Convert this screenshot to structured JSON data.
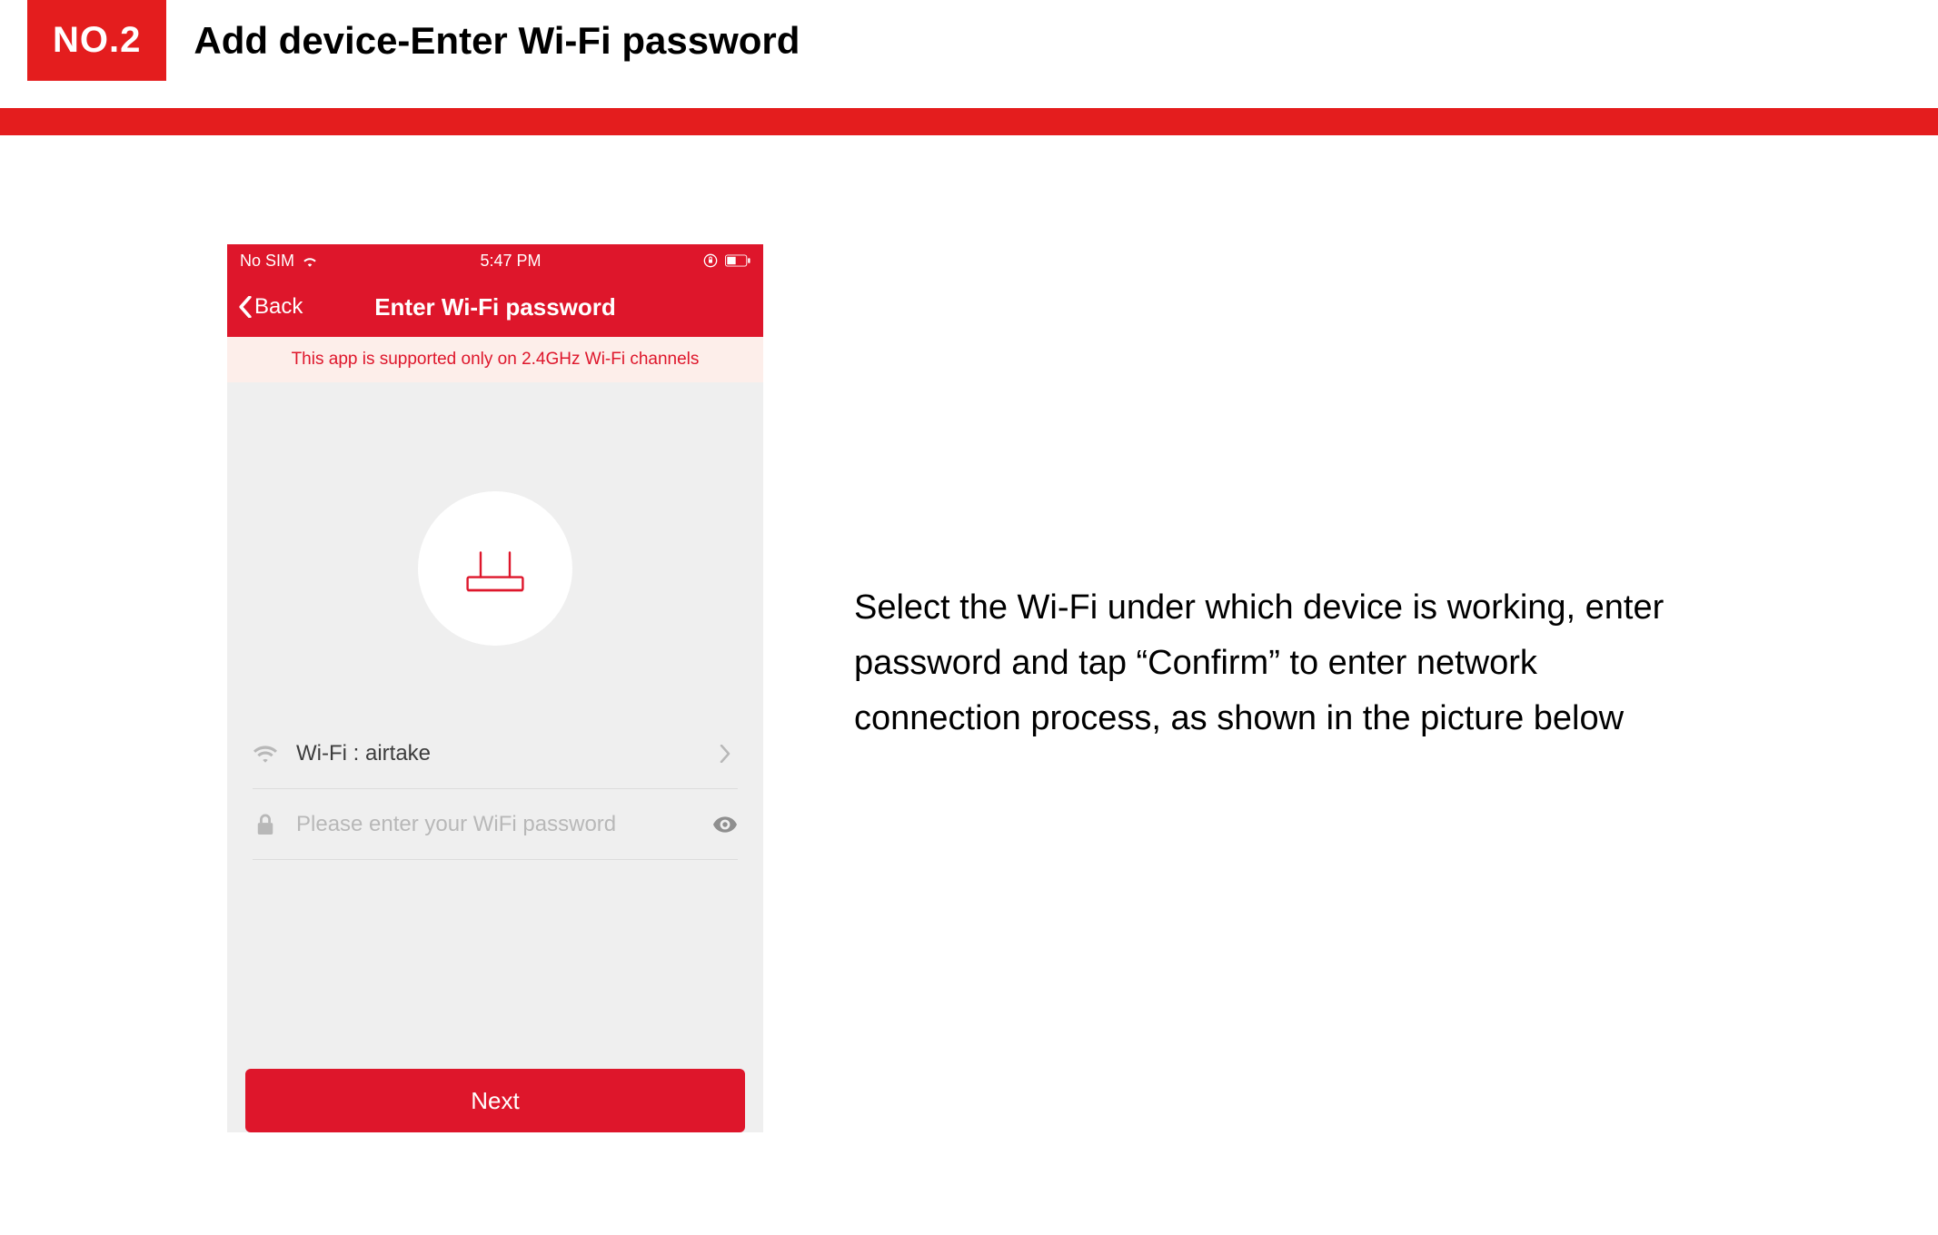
{
  "header": {
    "badge": "NO.2",
    "heading": "Add device-Enter Wi-Fi password"
  },
  "phone": {
    "status": {
      "carrier": "No SIM",
      "time": "5:47 PM"
    },
    "nav": {
      "back": "Back",
      "title": "Enter Wi-Fi password"
    },
    "banner": "This app is supported only on 2.4GHz Wi-Fi channels",
    "wifi_row": {
      "label": "Wi-Fi : airtake"
    },
    "password_row": {
      "placeholder": "Please enter your WiFi password",
      "value": ""
    },
    "next_label": "Next"
  },
  "description": "Select the Wi-Fi under which device is working, enter password and tap “Confirm” to enter network connection process, as shown in the picture below",
  "colors": {
    "brand_red": "#e41d1e",
    "app_red": "#de162b",
    "banner_bg": "#fdeeea",
    "grey_bg": "#efefef"
  }
}
